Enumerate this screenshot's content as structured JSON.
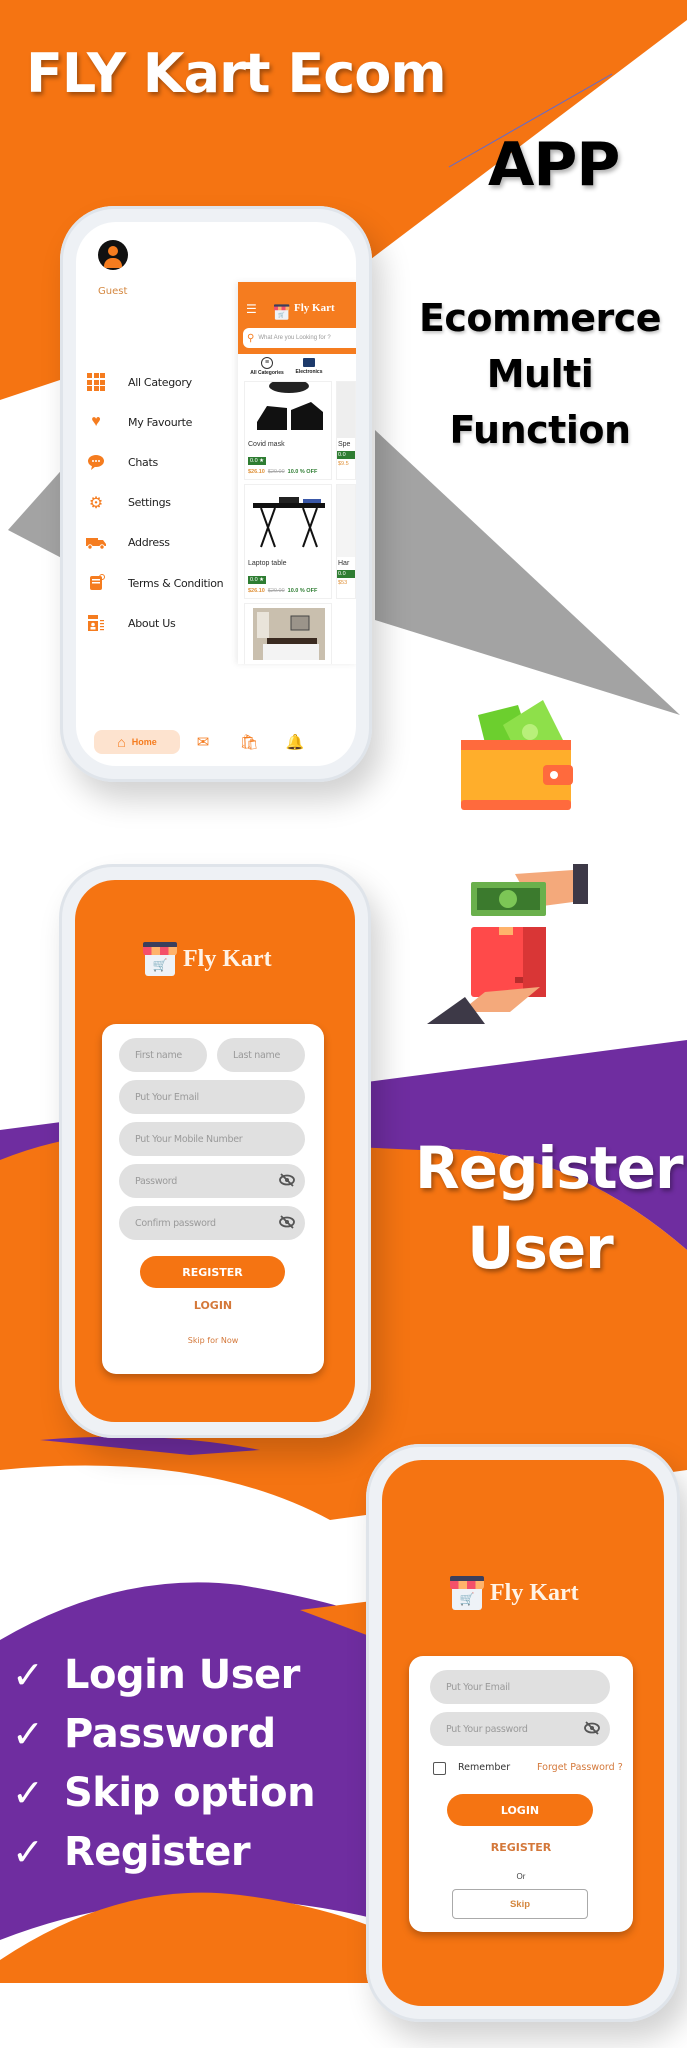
{
  "banner": {
    "title": "FLY Kart Ecom",
    "title_suffix": "APP",
    "subtitle_line1": "Ecommerce",
    "subtitle_line2": "Multi Function",
    "register_line1": "Register",
    "register_line2": "User",
    "features": [
      {
        "check": "✓",
        "label": "Login User"
      },
      {
        "check": "✓",
        "label": "Password"
      },
      {
        "check": "✓",
        "label": "Skip option"
      },
      {
        "check": "✓",
        "label": "Register"
      }
    ],
    "colors": {
      "orange": "#f57412",
      "purple": "#6f2da0",
      "grey": "#a3a3a3"
    }
  },
  "drawer_screen": {
    "user_name": "Guest",
    "menu": [
      {
        "icon": "grid-icon",
        "label": "All Category"
      },
      {
        "icon": "heart-icon",
        "label": "My Favourte"
      },
      {
        "icon": "chat-icon",
        "label": "Chats"
      },
      {
        "icon": "settings-icon",
        "label": "Settings"
      },
      {
        "icon": "truck-icon",
        "label": "Address"
      },
      {
        "icon": "terms-icon",
        "label": "Terms & Condition"
      },
      {
        "icon": "about-icon",
        "label": "About Us"
      }
    ],
    "home": {
      "app_name": "Fly Kart",
      "search_placeholder": "What Are you Looking for ?",
      "categories": [
        "All Categories",
        "Electronics"
      ],
      "products": [
        {
          "name": "Covid mask",
          "rating": "0.0",
          "price": "$26.10",
          "old_price": "$29.00",
          "discount": "10.0 % OFF",
          "peek_name": "Spe",
          "peek_rating": "0.0",
          "peek_price": "$9.5"
        },
        {
          "name": "Laptop table",
          "rating": "0.0",
          "price": "$26.10",
          "old_price": "$29.00",
          "discount": "10.0 % OFF",
          "peek_name": "Har",
          "peek_rating": "0.0",
          "peek_price": "$53"
        }
      ]
    },
    "bottom_nav": {
      "home_label": "Home"
    }
  },
  "register_screen": {
    "app_name": "Fly Kart",
    "first_name_placeholder": "First name",
    "last_name_placeholder": "Last name",
    "email_placeholder": "Put Your Email",
    "mobile_placeholder": "Put Your Mobile Number",
    "password_placeholder": "Password",
    "confirm_password_placeholder": "Confirm password",
    "register_button": "REGISTER",
    "login_link": "LOGIN",
    "skip_link": "Skip for Now"
  },
  "login_screen": {
    "app_name": "Fly Kart",
    "email_placeholder": "Put Your Email",
    "password_placeholder": "Put Your password",
    "remember_label": "Remember",
    "remember_checked": false,
    "forgot_link": "Forget Password ?",
    "login_button": "LOGIN",
    "register_link": "REGISTER",
    "or_label": "Or",
    "skip_button": "Skip"
  }
}
